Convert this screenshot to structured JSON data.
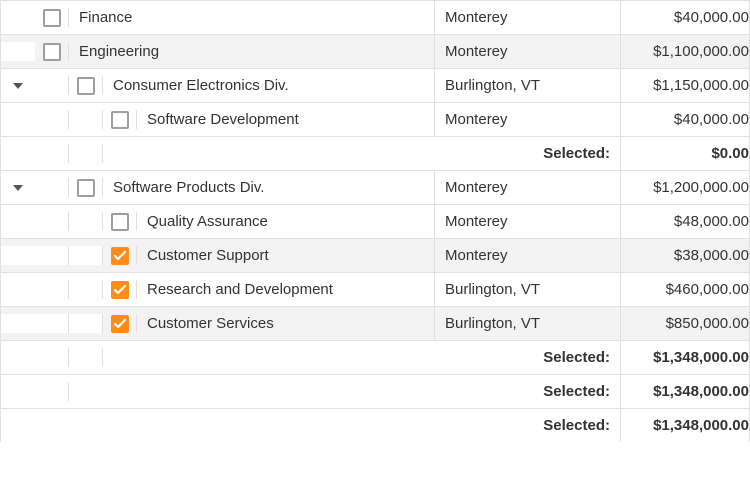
{
  "labels": {
    "selected": "Selected:"
  },
  "rows": [
    {
      "type": "data",
      "level": 0,
      "expander": false,
      "checkbox": true,
      "checked": false,
      "alt": false,
      "name": "Finance",
      "location": "Monterey",
      "budget": "$40,000.00"
    },
    {
      "type": "data",
      "level": 0,
      "expander": false,
      "checkbox": true,
      "checked": false,
      "alt": true,
      "name": "Engineering",
      "location": "Monterey",
      "budget": "$1,100,000.00"
    },
    {
      "type": "data",
      "level": 1,
      "expander": true,
      "checkbox": true,
      "checked": false,
      "alt": false,
      "name": "Consumer Electronics Div.",
      "location": "Burlington, VT",
      "budget": "$1,150,000.00"
    },
    {
      "type": "data",
      "level": 2,
      "expander": false,
      "checkbox": true,
      "checked": false,
      "alt": false,
      "name": "Software Development",
      "location": "Monterey",
      "budget": "$40,000.00"
    },
    {
      "type": "summary",
      "indent": 2,
      "value": "$0.00"
    },
    {
      "type": "data",
      "level": 1,
      "expander": true,
      "checkbox": true,
      "checked": false,
      "alt": false,
      "name": "Software Products Div.",
      "location": "Monterey",
      "budget": "$1,200,000.00"
    },
    {
      "type": "data",
      "level": 2,
      "expander": false,
      "checkbox": true,
      "checked": false,
      "alt": false,
      "name": "Quality Assurance",
      "location": "Monterey",
      "budget": "$48,000.00"
    },
    {
      "type": "data",
      "level": 2,
      "expander": false,
      "checkbox": true,
      "checked": true,
      "alt": true,
      "name": "Customer Support",
      "location": "Monterey",
      "budget": "$38,000.00"
    },
    {
      "type": "data",
      "level": 2,
      "expander": false,
      "checkbox": true,
      "checked": true,
      "alt": false,
      "name": "Research and Development",
      "location": "Burlington, VT",
      "budget": "$460,000.00"
    },
    {
      "type": "data",
      "level": 2,
      "expander": false,
      "checkbox": true,
      "checked": true,
      "alt": true,
      "name": "Customer Services",
      "location": "Burlington, VT",
      "budget": "$850,000.00"
    },
    {
      "type": "summary",
      "indent": 2,
      "value": "$1,348,000.00"
    },
    {
      "type": "summary",
      "indent": 1,
      "value": "$1,348,000.00"
    },
    {
      "type": "summary",
      "indent": 0,
      "value": "$1,348,000.00"
    }
  ]
}
